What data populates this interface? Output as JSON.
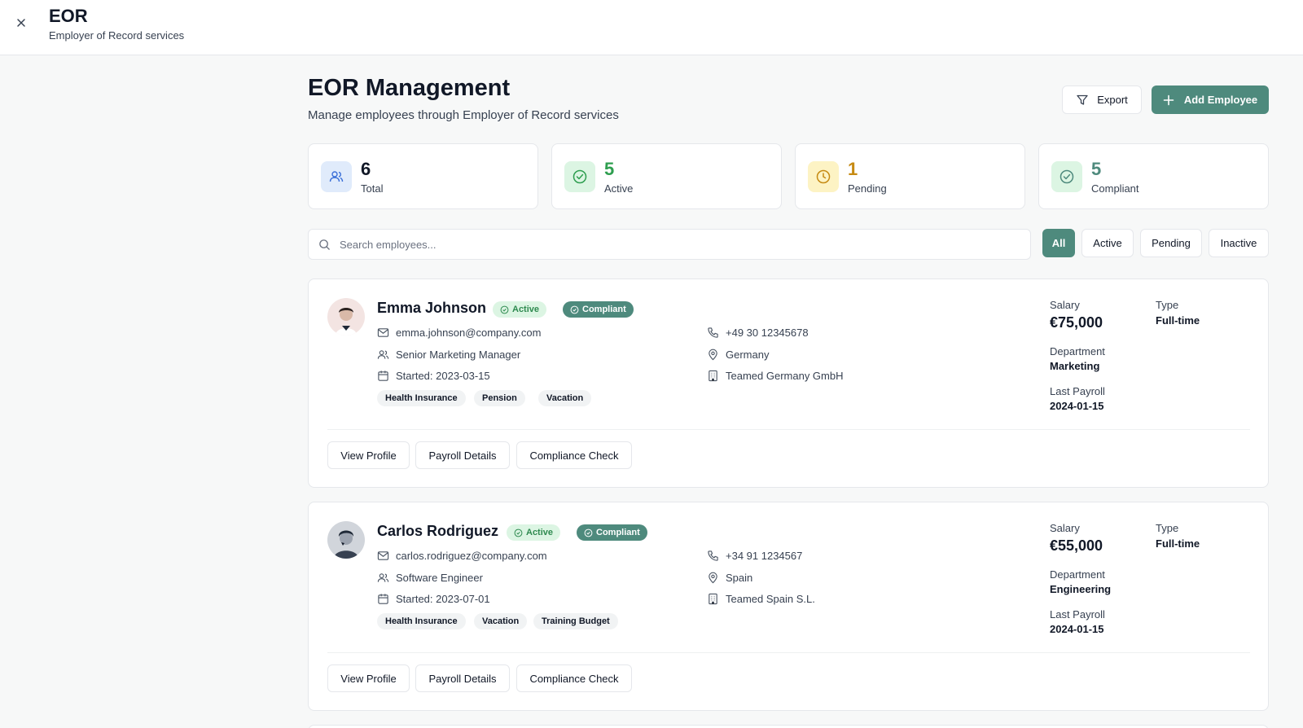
{
  "header": {
    "title": "EOR",
    "subtitle": "Employer of Record services"
  },
  "page": {
    "title": "EOR Management",
    "subtitle": "Manage employees through Employer of Record services"
  },
  "toolbar": {
    "export_label": "Export",
    "add_label": "Add Employee"
  },
  "stats": [
    {
      "value": "6",
      "label": "Total",
      "color": "#111827",
      "icon": "users-icon"
    },
    {
      "value": "5",
      "label": "Active",
      "color": "#2e9e4f",
      "icon": "check-circle-icon"
    },
    {
      "value": "1",
      "label": "Pending",
      "color": "#c68a12",
      "icon": "clock-icon"
    },
    {
      "value": "5",
      "label": "Compliant",
      "color": "#4e8a7d",
      "icon": "check-circle-icon"
    }
  ],
  "search": {
    "placeholder": "Search employees...",
    "value": ""
  },
  "filters": [
    "All",
    "Active",
    "Pending",
    "Inactive"
  ],
  "selected_filter": "All",
  "employees": [
    {
      "name": "Emma Johnson",
      "status": "Active",
      "compliance": "Compliant",
      "email": "emma.johnson@company.com",
      "role": "Senior Marketing Manager",
      "started": "Started: 2023-03-15",
      "phone": "+49 30 12345678",
      "country": "Germany",
      "entity": "Teamed Germany GmbH",
      "benefits": [
        "Health Insurance",
        "Pension",
        "Vacation"
      ],
      "salary_label": "Salary",
      "salary": "€75,000",
      "type_label": "Type",
      "type": "Full-time",
      "department_label": "Department",
      "department": "Marketing",
      "payroll_label": "Last Payroll",
      "payroll": "2024-01-15"
    },
    {
      "name": "Carlos Rodriguez",
      "status": "Active",
      "compliance": "Compliant",
      "email": "carlos.rodriguez@company.com",
      "role": "Software Engineer",
      "started": "Started: 2023-07-01",
      "phone": "+34 91 1234567",
      "country": "Spain",
      "entity": "Teamed Spain S.L.",
      "benefits": [
        "Health Insurance",
        "Vacation",
        "Training Budget"
      ],
      "salary_label": "Salary",
      "salary": "€55,000",
      "type_label": "Type",
      "type": "Full-time",
      "department_label": "Department",
      "department": "Engineering",
      "payroll_label": "Last Payroll",
      "payroll": "2024-01-15"
    }
  ],
  "card_actions": [
    "View Profile",
    "Payroll Details",
    "Compliance Check"
  ],
  "colors": {
    "accent": "#4e8a7d",
    "active_badge_bg": "#dcf5e3",
    "active_badge_text": "#2e8a4f"
  }
}
